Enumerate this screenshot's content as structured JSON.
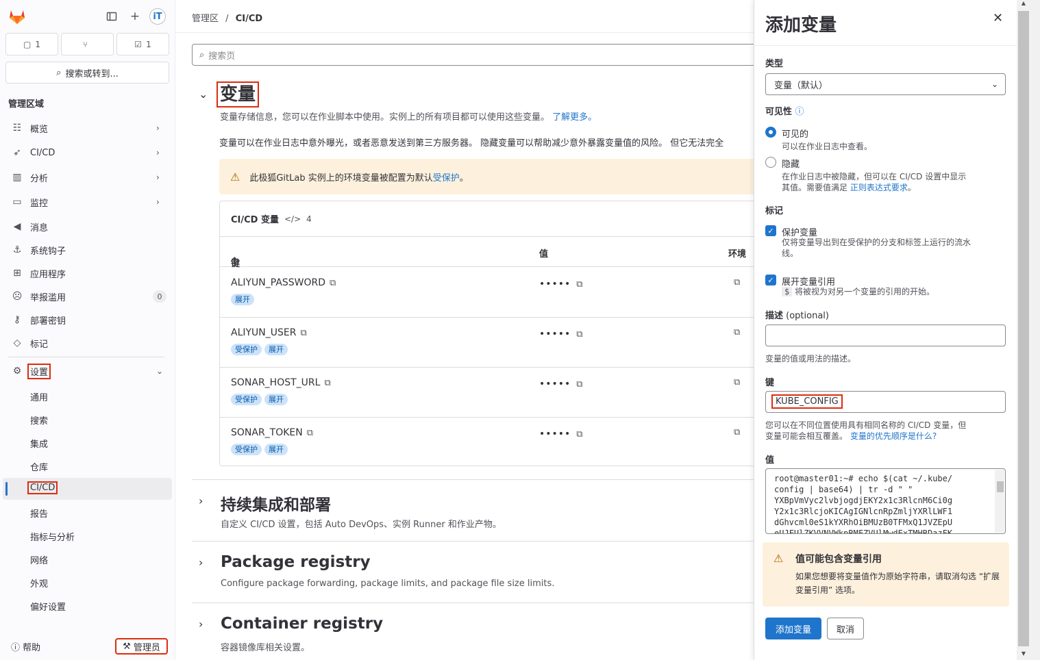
{
  "sidebar": {
    "counters": [
      "1",
      "",
      "1"
    ],
    "search_label": "搜索或转到...",
    "section_title": "管理区域",
    "nav": [
      {
        "label": "概览",
        "icon": "overview-icon"
      },
      {
        "label": "CI/CD",
        "icon": "rocket-icon"
      },
      {
        "label": "分析",
        "icon": "chart-icon"
      },
      {
        "label": "监控",
        "icon": "monitor-icon"
      },
      {
        "label": "消息",
        "icon": "bullhorn-icon"
      },
      {
        "label": "系统钩子",
        "icon": "hook-icon"
      },
      {
        "label": "应用程序",
        "icon": "apps-icon"
      },
      {
        "label": "举报滥用",
        "icon": "abuse-icon"
      },
      {
        "label": "部署密钥",
        "icon": "key-icon"
      },
      {
        "label": "标记",
        "icon": "label-icon"
      }
    ],
    "abuse_count": "0",
    "settings_label": "设置",
    "settings_sub": [
      "通用",
      "搜索",
      "集成",
      "仓库",
      "CI/CD",
      "报告",
      "指标与分析",
      "网络",
      "外观",
      "偏好设置"
    ],
    "help_label": "帮助",
    "admin_label": "管理员"
  },
  "breadcrumb": {
    "root": "管理区",
    "sep": "/",
    "current": "CI/CD"
  },
  "search": {
    "placeholder": "搜索页"
  },
  "variables": {
    "title": "变量",
    "desc": "变量存储信息，您可以在作业脚本中使用。实例上的所有项目都可以使用这些变量。",
    "learn_more": "了解更多。",
    "desc2": "变量可以在作业日志中意外曝光，或者恶意发送到第三方服务器。 隐藏变量可以帮助减少意外暴露变量值的风险。 但它无法完全",
    "alert_text": "此极狐GitLab 实例上的环境变量被配置为默认",
    "alert_link": "受保护",
    "alert_end": "。",
    "card_title": "CI/CD 变量",
    "card_count": "4",
    "col_key": "键",
    "col_value": "值",
    "col_env": "环境",
    "rows": [
      {
        "key": "ALIYUN_PASSWORD",
        "tags": [
          "展开"
        ],
        "value": "•••••"
      },
      {
        "key": "ALIYUN_USER",
        "tags": [
          "受保护",
          "展开"
        ],
        "value": "•••••"
      },
      {
        "key": "SONAR_HOST_URL",
        "tags": [
          "受保护",
          "展开"
        ],
        "value": "•••••"
      },
      {
        "key": "SONAR_TOKEN",
        "tags": [
          "受保护",
          "展开"
        ],
        "value": "•••••"
      }
    ]
  },
  "sections": [
    {
      "title": "持续集成和部署",
      "desc": "自定义 CI/CD 设置，包括 Auto DevOps、实例 Runner 和作业产物。"
    },
    {
      "title": "Package registry",
      "desc": "Configure package forwarding, package limits, and package file size limits."
    },
    {
      "title": "Container registry",
      "desc": "容器镜像库相关设置。"
    }
  ],
  "drawer": {
    "title": "添加变量",
    "type_label": "类型",
    "type_value": "变量（默认）",
    "visibility_label": "可见性",
    "visible_label": "可见的",
    "visible_help": "可以在作业日志中查看。",
    "masked_label": "隐藏",
    "masked_help1": "在作业日志中被隐藏，但可以在 CI/CD 设置中显示",
    "masked_help2": "其值。需要值满足 ",
    "masked_link": "正则表达式要求",
    "masked_end": "。",
    "flags_label": "标记",
    "protect_label": "保护变量",
    "protect_help1": "仅将变量导出到在受保护的分支和标签上运行的流水",
    "protect_help2": "线。",
    "expand_label": "展开变量引用",
    "expand_code": "$",
    "expand_help": " 将被视为对另一个变量的引用的开始。",
    "desc_label": "描述",
    "desc_optional": " (optional)",
    "desc_help": "变量的值或用法的描述。",
    "key_label": "键",
    "key_value": "KUBE_CONFIG",
    "key_help1": "您可以在不同位置使用具有相同名称的 CI/CD 变量，但",
    "key_help2": "变量可能会相互覆盖。 ",
    "key_link": "变量的优先顺序是什么?",
    "value_label": "值",
    "value_lines": [
      "root@master01:~# echo $(cat ~/.kube/",
      "config | base64) | tr -d \" \"",
      "YXBpVmVyc2lvbjogdjEKY2x1c3RlcnM6Ci0g",
      "Y2x1c3RlcjoKICAgIGNlcnRpZmljYXRlLWF1",
      "dGhvcml0eS1kYXRhOiBMUzB0TFMxQ1JVZEpU",
      "eUJFUlZKVVNVWkpRMFZVUlMwdExTMHRDazFK"
    ],
    "warn_title": "值可能包含变量引用",
    "warn_desc": "如果您想要将变量值作为原始字符串，请取消勾选 “扩展变量引用” 选项。",
    "add_button": "添加变量",
    "cancel_button": "取消"
  },
  "colors": {
    "accent": "#1f75cb",
    "highlight": "#dd2b0e",
    "warning_bg": "#fdf1dd"
  }
}
